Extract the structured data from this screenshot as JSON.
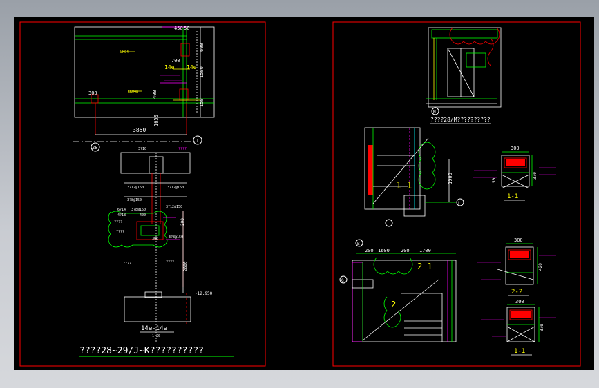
{
  "sheet_left": {
    "title": "????28~29/J~K??????????",
    "axis_28": "28",
    "axis_j": "J",
    "dims": {
      "d3850": "3850",
      "d1650": "1650",
      "d300": "300",
      "d450": "450",
      "d50": "50",
      "d600": "600",
      "d1500": "1500",
      "d700": "700",
      "d400": "400",
      "d150": "150",
      "d200": "200",
      "d2800": "2800"
    },
    "labels": {
      "lkl4": "LK04",
      "lkl4b": "LK04a",
      "e14a": "14e",
      "e14b": "14e",
      "section_14e": "14e-14e",
      "scale": "1:20",
      "elev": "-12.950",
      "c3210": "3?10",
      "c3_12": "3?12@150",
      "c3_8": "3?8@150",
      "c6_14": "6?14",
      "c4_18": "4?18",
      "q1": "????",
      "q2": "????",
      "q3": "????",
      "q4": "????",
      "q5": "????"
    }
  },
  "sheet_right": {
    "detail_m_caption": "????28/M??????????",
    "detail_m_tag": "M",
    "detail_l_tag": "L",
    "detail_g_tag": "G",
    "detail_b_tag": "B",
    "label_1_1": "1 1",
    "label_2_1": "2 1",
    "label_2_2": "2",
    "dims": {
      "d300a": "300",
      "d300b": "300",
      "d300c": "300",
      "d370a": "370",
      "d370b": "370",
      "d420": "420",
      "d1900": "1900",
      "d1600": "1600",
      "d200a": "200",
      "d1700": "1700",
      "d200b": "200",
      "d50": "50"
    },
    "sections": {
      "s1": "1-1",
      "s2": "2-2",
      "s3": "1-1"
    }
  },
  "colors": {
    "frame": "#ff0000",
    "green": "#00ff00",
    "magenta": "#ff00ff",
    "white": "#ffffff",
    "yellow": "#ffff00",
    "cyan": "#00ffff"
  }
}
